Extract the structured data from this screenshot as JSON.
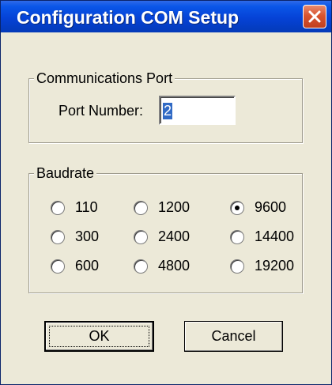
{
  "window": {
    "title": "Configuration COM Setup",
    "close_icon": "close-icon"
  },
  "comm_port": {
    "legend": "Communications Port",
    "port_label": "Port Number:",
    "port_value": "2"
  },
  "baudrate": {
    "legend": "Baudrate",
    "selected": "9600",
    "options": [
      "110",
      "1200",
      "9600",
      "300",
      "2400",
      "14400",
      "600",
      "4800",
      "19200"
    ]
  },
  "buttons": {
    "ok": "OK",
    "cancel": "Cancel"
  },
  "colors": {
    "title_bar": "#0542d6",
    "close_button": "#d8542f",
    "dialog_bg": "#ece9d8",
    "selection": "#316ac5"
  }
}
